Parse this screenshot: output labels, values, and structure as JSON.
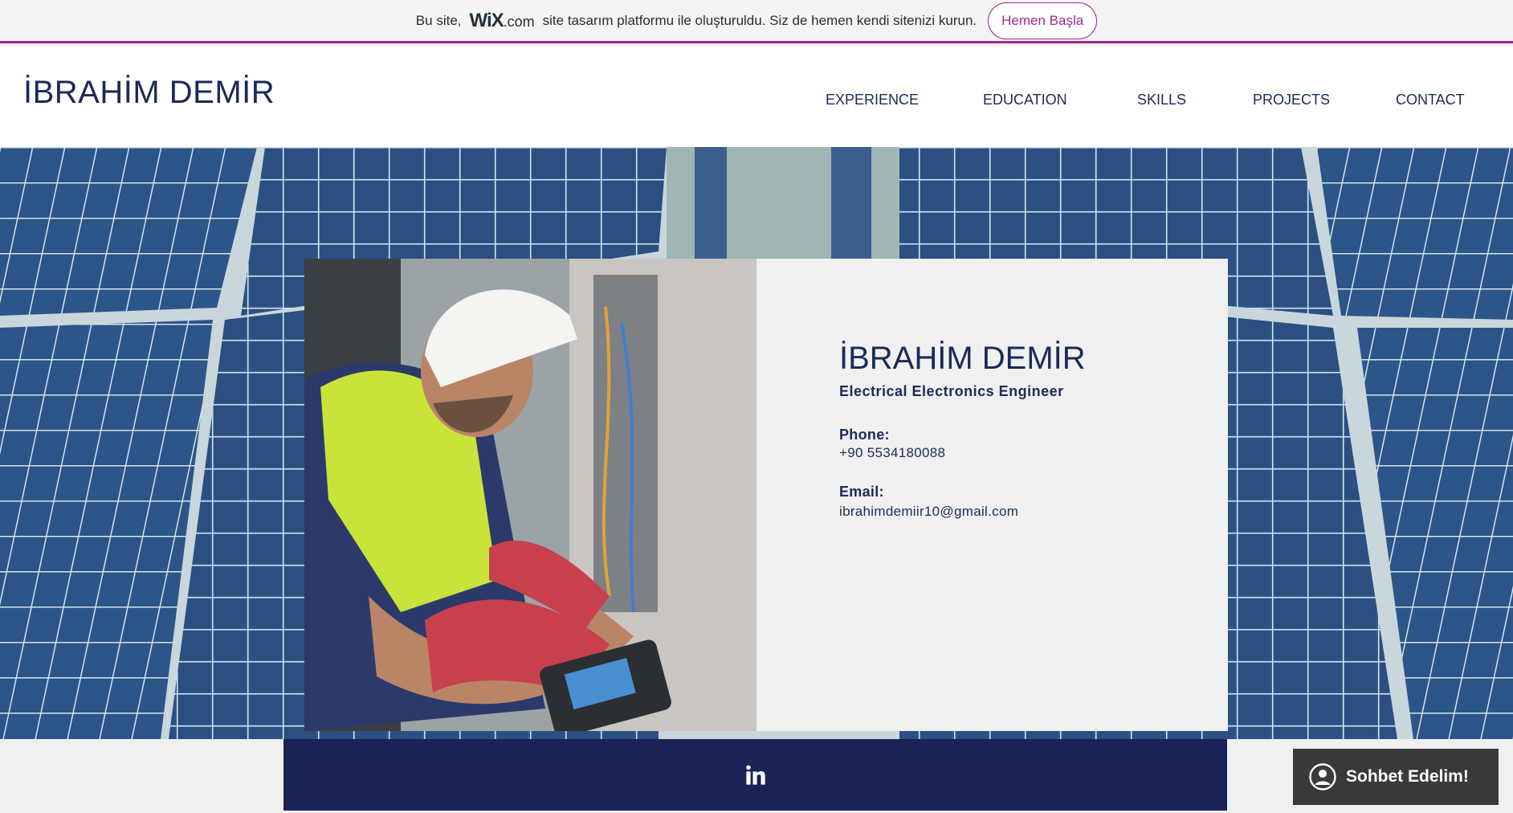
{
  "wix_banner": {
    "text_before": "Bu site,",
    "logo_main": "WiX",
    "logo_suffix": ".com",
    "text_after": "site tasarım platformu ile oluşturuldu. Siz de hemen kendi sitenizi kurun.",
    "button_label": "Hemen Başla",
    "accent_color": "#9e2a8f"
  },
  "header": {
    "site_name": "İBRAHİM DEMİR",
    "nav": [
      "EXPERIENCE",
      "EDUCATION",
      "SKILLS",
      "PROJECTS",
      "CONTACT"
    ]
  },
  "profile": {
    "name": "İBRAHİM DEMİR",
    "title": "Electrical Electronics Engineer",
    "phone_label": "Phone:",
    "phone": "+90 5534180088",
    "email_label": "Email:",
    "email": "ibrahimdemiir10@gmail.com",
    "photo_icon": "engineer-photo"
  },
  "social": {
    "linkedin_icon": "linkedin-icon",
    "strip_color": "#1a2357"
  },
  "chat": {
    "label": "Sohbet Edelim!",
    "icon": "user-avatar-icon"
  },
  "colors": {
    "text_primary": "#1c2a57",
    "card_bg": "#f0f0f0"
  }
}
